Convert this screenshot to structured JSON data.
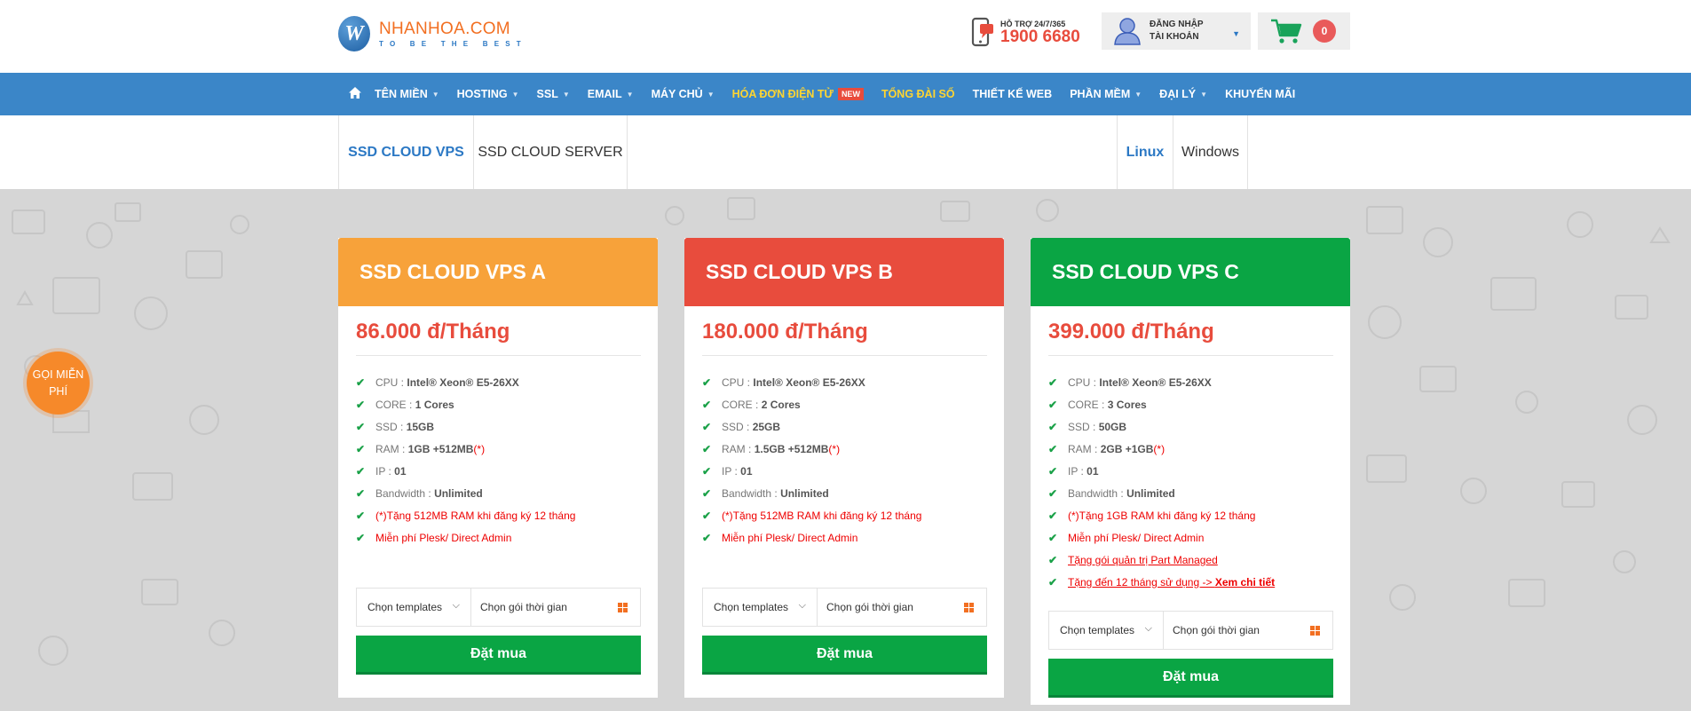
{
  "header": {
    "logo_letter": "W",
    "logo_name": "NHANHOA.COM",
    "logo_tagline": "TO BE THE BEST",
    "support_label": "HỖ TRỢ 24/7/365",
    "support_phone": "1900 6680",
    "login_line1": "ĐĂNG NHẬP",
    "login_line2": "TÀI KHOẢN",
    "cart_count": "0"
  },
  "nav": {
    "items": [
      {
        "label": "TÊN MIỀN",
        "dropdown": true
      },
      {
        "label": "HOSTING",
        "dropdown": true
      },
      {
        "label": "SSL",
        "dropdown": true
      },
      {
        "label": "EMAIL",
        "dropdown": true
      },
      {
        "label": "MÁY CHỦ",
        "dropdown": true
      },
      {
        "label": "HÓA ĐƠN ĐIỆN TỬ",
        "badge": "NEW"
      },
      {
        "label": "TỔNG ĐÀI SỐ"
      },
      {
        "label": "THIẾT KẾ WEB"
      },
      {
        "label": "PHẦN MỀM",
        "dropdown": true
      },
      {
        "label": "ĐẠI LÝ",
        "dropdown": true
      },
      {
        "label": "KHUYẾN MÃI"
      }
    ]
  },
  "tabs": {
    "product": [
      "SSD CLOUD VPS",
      "SSD CLOUD SERVER"
    ],
    "os": [
      "Linux",
      "Windows"
    ]
  },
  "call_button": {
    "line1": "GỌI MIỄN",
    "line2": "PHÍ"
  },
  "colors": {
    "nav": "#3b86c8",
    "card_a": "#f7a23a",
    "card_b": "#e84c3d",
    "card_c": "#0aa544",
    "buy": "#0aa544",
    "price": "#e84c3d"
  },
  "cards": [
    {
      "title": "SSD CLOUD VPS A",
      "price": "86.000 đ/Tháng",
      "cpu_label": "CPU :",
      "cpu": "Intel® Xeon® E5-26XX",
      "core_label": "CORE :",
      "core": "1 Cores",
      "ssd_label": "SSD :",
      "ssd": "15GB",
      "ram_label": "RAM :",
      "ram": "1GB",
      "ram_bonus": "+512MB",
      "ram_note": "(*)",
      "ip_label": "IP :",
      "ip": "01",
      "bw_label": "Bandwidth :",
      "bw": "Unlimited",
      "promo1": "(*)Tặng 512MB RAM khi đăng ký 12 tháng",
      "promo2": "Miễn phí Plesk/ Direct Admin",
      "select_template": "Chọn templates",
      "select_time": "Chọn gói thời gian",
      "buy": "Đặt mua"
    },
    {
      "title": "SSD CLOUD VPS B",
      "price": "180.000 đ/Tháng",
      "cpu_label": "CPU :",
      "cpu": "Intel® Xeon® E5-26XX",
      "core_label": "CORE :",
      "core": "2 Cores",
      "ssd_label": "SSD :",
      "ssd": "25GB",
      "ram_label": "RAM :",
      "ram": "1.5GB",
      "ram_bonus": "+512MB",
      "ram_note": "(*)",
      "ip_label": "IP :",
      "ip": "01",
      "bw_label": "Bandwidth :",
      "bw": "Unlimited",
      "promo1": "(*)Tặng 512MB RAM khi đăng ký 12 tháng",
      "promo2": "Miễn phí Plesk/ Direct Admin",
      "select_template": "Chọn templates",
      "select_time": "Chọn gói thời gian",
      "buy": "Đặt mua"
    },
    {
      "title": "SSD CLOUD VPS C",
      "price": "399.000 đ/Tháng",
      "cpu_label": "CPU :",
      "cpu": "Intel® Xeon® E5-26XX",
      "core_label": "CORE :",
      "core": "3 Cores",
      "ssd_label": "SSD :",
      "ssd": "50GB",
      "ram_label": "RAM :",
      "ram": "2GB",
      "ram_bonus": "+1GB",
      "ram_note": "(*)",
      "ip_label": "IP :",
      "ip": "01",
      "bw_label": "Bandwidth :",
      "bw": "Unlimited",
      "promo1": "(*)Tặng 1GB RAM khi đăng ký 12 tháng",
      "promo2": "Miễn phí Plesk/ Direct Admin",
      "promo3": "Tặng gói quản trị Part Managed",
      "promo4": "Tặng đến 12 tháng sử dụng -> ",
      "promo4_link": "Xem chi tiết",
      "select_template": "Chọn templates",
      "select_time": "Chọn gói thời gian",
      "buy": "Đặt mua"
    }
  ]
}
